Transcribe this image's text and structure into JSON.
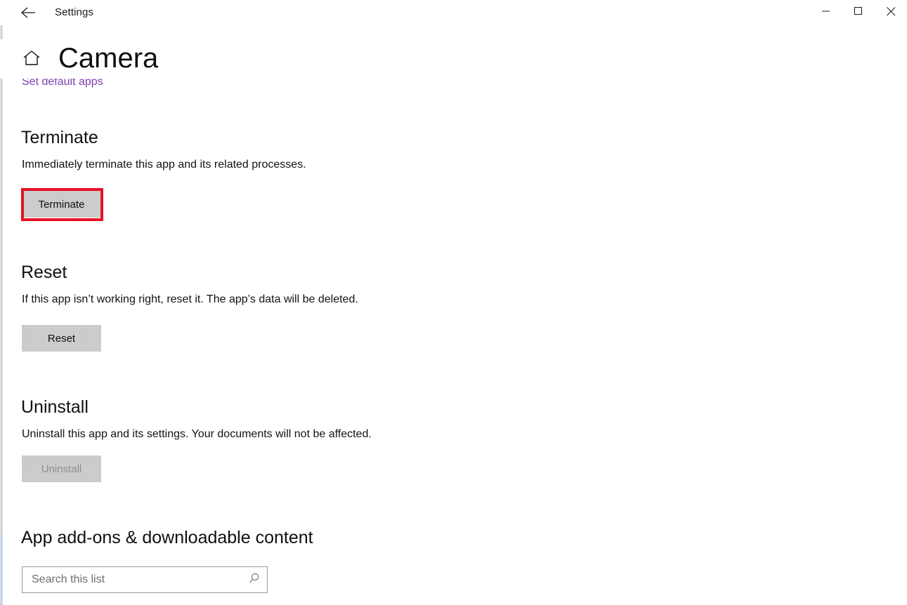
{
  "window": {
    "title": "Settings",
    "back_icon": "back-arrow-icon",
    "minimize_icon": "minimize-icon",
    "maximize_icon": "maximize-icon",
    "close_icon": "close-icon"
  },
  "header": {
    "home_icon": "home-icon",
    "page_title": "Camera"
  },
  "links": {
    "set_default_apps": "Set default apps"
  },
  "sections": [
    {
      "heading": "Terminate",
      "description": "Immediately terminate this app and its related processes.",
      "button_label": "Terminate",
      "disabled": false,
      "highlighted": true
    },
    {
      "heading": "Reset",
      "description": "If this app isn’t working right, reset it. The app’s data will be deleted.",
      "button_label": "Reset",
      "disabled": false,
      "highlighted": false
    },
    {
      "heading": "Uninstall",
      "description": "Uninstall this app and its settings. Your documents will not be affected.",
      "button_label": "Uninstall",
      "disabled": true,
      "highlighted": false
    }
  ],
  "addons": {
    "heading": "App add-ons & downloadable content",
    "search_placeholder": "Search this list",
    "search_value": "",
    "search_icon": "search-icon"
  },
  "colors": {
    "highlight_red": "#e81123",
    "link_purple": "#7a3fb5",
    "button_grey": "#cccccc",
    "disabled_text": "#8e8e8e",
    "page_background": "#ffffff"
  }
}
